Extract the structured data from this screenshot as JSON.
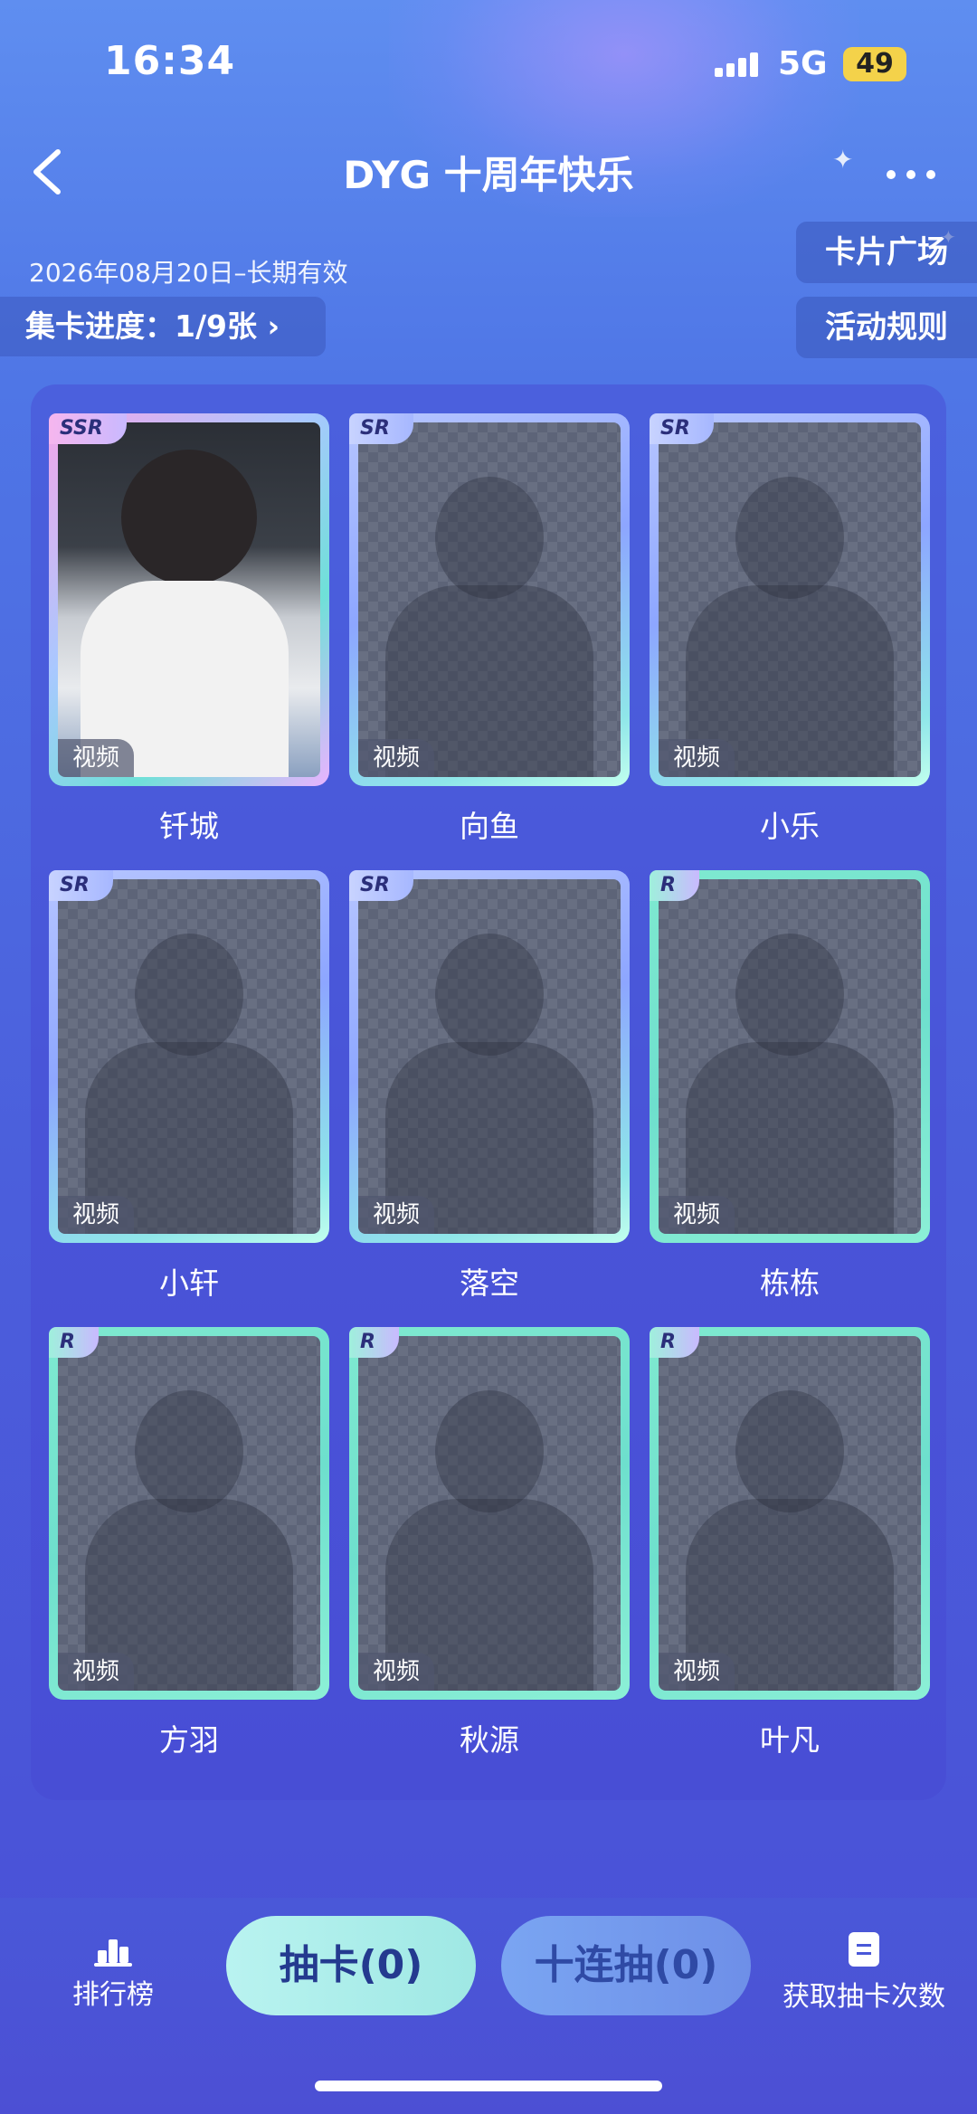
{
  "status_bar": {
    "time": "16:34",
    "network": "5G",
    "battery": "49"
  },
  "header": {
    "title": "DYG 十周年快乐"
  },
  "info": {
    "validity": "2026年08月20日–长期有效",
    "progress": "集卡进度：1/9张 ›"
  },
  "side_buttons": {
    "card_square": "卡片广场",
    "rules": "活动规则"
  },
  "cards": [
    {
      "name": "钎城",
      "rarity": "SSR",
      "tag": "视频",
      "collected": true
    },
    {
      "name": "向鱼",
      "rarity": "SR",
      "tag": "视频",
      "collected": false
    },
    {
      "name": "小乐",
      "rarity": "SR",
      "tag": "视频",
      "collected": false
    },
    {
      "name": "小轩",
      "rarity": "SR",
      "tag": "视频",
      "collected": false
    },
    {
      "name": "落空",
      "rarity": "SR",
      "tag": "视频",
      "collected": false
    },
    {
      "name": "栋栋",
      "rarity": "R",
      "tag": "视频",
      "collected": false
    },
    {
      "name": "方羽",
      "rarity": "R",
      "tag": "视频",
      "collected": false
    },
    {
      "name": "秋源",
      "rarity": "R",
      "tag": "视频",
      "collected": false
    },
    {
      "name": "叶凡",
      "rarity": "R",
      "tag": "视频",
      "collected": false
    }
  ],
  "bottom_bar": {
    "rank_label": "排行榜",
    "draw_label": "抽卡(0)",
    "ten_draw_label": "十连抽(0)",
    "get_draws_label": "获取抽卡次数"
  },
  "icons": {
    "back": "back-chevron-icon",
    "more": "more-dots-icon",
    "rank": "bar-chart-icon",
    "get_draws": "document-icon"
  }
}
